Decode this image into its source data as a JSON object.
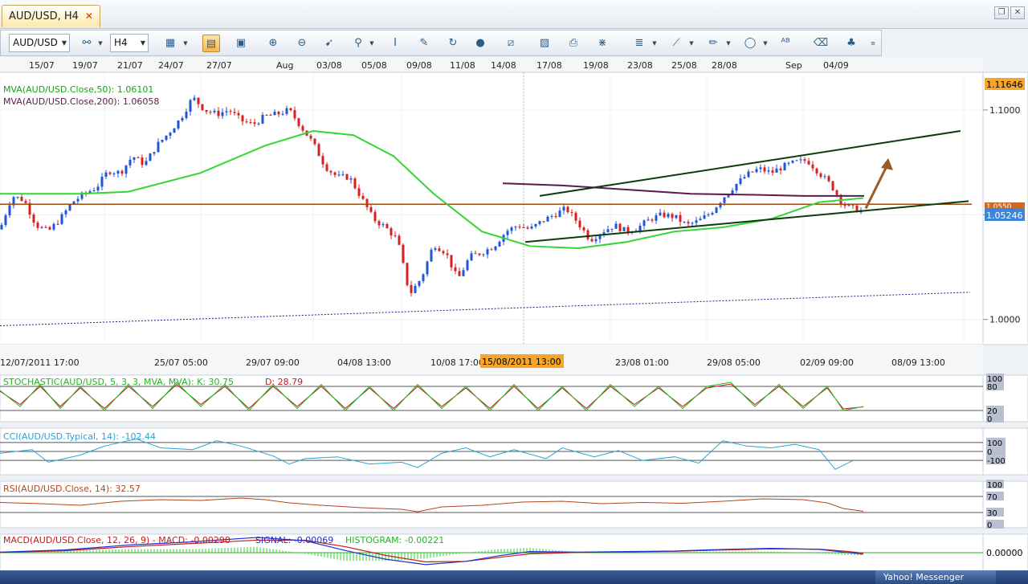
{
  "tab": {
    "label": "AUD/USD, H4",
    "close": "✕"
  },
  "window_controls": {
    "restore": "❐",
    "close": "✕"
  },
  "toolbar": {
    "symbol": "AUD/USD",
    "timeframe": "H4",
    "buttons": [
      "bar-chart-icon",
      "candle-icon",
      "line-icon",
      "crosshair-icon",
      "zoom-in-icon",
      "zoom-out-icon",
      "cursor-icon",
      "magnifier-icon",
      "indicator-icon",
      "draw-icon",
      "refresh-icon",
      "globe-icon",
      "ruler-icon",
      "image-icon",
      "print-icon",
      "fibonacci-icon",
      "channel-icon",
      "trend-icon",
      "pencil-icon",
      "ellipse-icon",
      "text-icon",
      "eraser-icon",
      "tree-icon"
    ]
  },
  "top_dates": [
    "15/07",
    "19/07",
    "21/07",
    "24/07",
    "27/07",
    "Aug",
    "03/08",
    "05/08",
    "09/08",
    "11/08",
    "14/08",
    "17/08",
    "19/08",
    "23/08",
    "25/08",
    "28/08",
    "Sep",
    "04/09"
  ],
  "bottom_dates": [
    "12/07/2011 17:00",
    "25/07 05:00",
    "29/07 09:00",
    "04/08 13:00",
    "10/08 17:00",
    "15/08/2011 13:00",
    "23/08 01:00",
    "29/08 05:00",
    "02/09 09:00",
    "08/09 13:00"
  ],
  "crosshair_date": "15/08/2011 13:00",
  "legend": {
    "mva50": "MVA(AUD/USD.Close,50): 1.06101",
    "mva200": "MVA(AUD/USD.Close,200): 1.06058"
  },
  "price_labels": {
    "top": "1.11646",
    "current": "1.05246",
    "covered": "1.0550",
    "ticks": [
      "1.1000",
      "1.0500",
      "1.0000"
    ]
  },
  "indicators": {
    "stochastic": {
      "label": "STOCHASTIC(AUD/USD, 5, 3, 3, MVA, MVA): K: 30.75",
      "d": "D: 28.79",
      "scale": [
        "100",
        "80",
        "20",
        "0"
      ]
    },
    "cci": {
      "label": "CCI(AUD/USD.Typical, 14): -102.44",
      "scale": [
        "100",
        "0",
        "-100"
      ]
    },
    "rsi": {
      "label": "RSI(AUD/USD.Close, 14): 32.57",
      "scale": [
        "100",
        "70",
        "30",
        "0"
      ]
    },
    "macd": {
      "label": "MACD(AUD/USD.Close, 12, 26, 9) - MACD: -0.00290",
      "signal": "SIGNAL: -0.00069",
      "histogram": "HISTOGRAM: -0.00221",
      "scale": [
        "0.00000"
      ]
    }
  },
  "status": {
    "messenger": "Yahoo! Messenger"
  },
  "chart_data": {
    "type": "candlestick",
    "title": "AUD/USD, H4",
    "ylim": [
      0.988,
      1.118
    ],
    "close_series": [
      [
        0,
        1.043
      ],
      [
        15,
        1.059
      ],
      [
        30,
        1.057
      ],
      [
        45,
        1.045
      ],
      [
        60,
        1.042
      ],
      [
        75,
        1.048
      ],
      [
        90,
        1.056
      ],
      [
        105,
        1.06
      ],
      [
        120,
        1.063
      ],
      [
        135,
        1.071
      ],
      [
        150,
        1.07
      ],
      [
        165,
        1.078
      ],
      [
        180,
        1.074
      ],
      [
        195,
        1.083
      ],
      [
        210,
        1.089
      ],
      [
        225,
        1.096
      ],
      [
        240,
        1.106
      ],
      [
        255,
        1.1
      ],
      [
        270,
        1.098
      ],
      [
        285,
        1.1
      ],
      [
        300,
        1.095
      ],
      [
        315,
        1.093
      ],
      [
        330,
        1.097
      ],
      [
        345,
        1.098
      ],
      [
        360,
        1.1
      ],
      [
        375,
        1.092
      ],
      [
        390,
        1.084
      ],
      [
        405,
        1.073
      ],
      [
        420,
        1.068
      ],
      [
        435,
        1.068
      ],
      [
        450,
        1.058
      ],
      [
        465,
        1.048
      ],
      [
        480,
        1.044
      ],
      [
        495,
        1.038
      ],
      [
        510,
        1.012
      ],
      [
        525,
        1.02
      ],
      [
        540,
        1.036
      ],
      [
        555,
        1.032
      ],
      [
        570,
        1.019
      ],
      [
        585,
        1.03
      ],
      [
        600,
        1.032
      ],
      [
        615,
        1.035
      ],
      [
        630,
        1.042
      ],
      [
        645,
        1.045
      ],
      [
        660,
        1.043
      ],
      [
        675,
        1.047
      ],
      [
        690,
        1.05
      ],
      [
        705,
        1.053
      ],
      [
        720,
        1.046
      ],
      [
        735,
        1.038
      ],
      [
        750,
        1.042
      ],
      [
        765,
        1.045
      ],
      [
        780,
        1.042
      ],
      [
        795,
        1.044
      ],
      [
        810,
        1.048
      ],
      [
        825,
        1.05
      ],
      [
        840,
        1.049
      ],
      [
        855,
        1.045
      ],
      [
        870,
        1.047
      ],
      [
        885,
        1.051
      ],
      [
        900,
        1.058
      ],
      [
        915,
        1.064
      ],
      [
        930,
        1.069
      ],
      [
        945,
        1.072
      ],
      [
        960,
        1.07
      ],
      [
        975,
        1.073
      ],
      [
        990,
        1.075
      ],
      [
        1005,
        1.076
      ],
      [
        1020,
        1.07
      ],
      [
        1035,
        1.064
      ],
      [
        1050,
        1.055
      ],
      [
        1062,
        1.053
      ],
      [
        1072,
        1.052
      ]
    ],
    "mva50_series": [
      [
        0,
        1.06
      ],
      [
        100,
        1.06
      ],
      [
        160,
        1.061
      ],
      [
        250,
        1.07
      ],
      [
        330,
        1.083
      ],
      [
        390,
        1.09
      ],
      [
        440,
        1.088
      ],
      [
        490,
        1.078
      ],
      [
        540,
        1.06
      ],
      [
        600,
        1.042
      ],
      [
        660,
        1.035
      ],
      [
        720,
        1.034
      ],
      [
        780,
        1.037
      ],
      [
        840,
        1.042
      ],
      [
        900,
        1.044
      ],
      [
        960,
        1.048
      ],
      [
        1020,
        1.056
      ],
      [
        1075,
        1.058
      ]
    ],
    "mva200_series": [
      [
        626,
        1.065
      ],
      [
        700,
        1.064
      ],
      [
        780,
        1.062
      ],
      [
        860,
        1.06
      ],
      [
        940,
        1.0595
      ],
      [
        1000,
        1.059
      ],
      [
        1050,
        1.059
      ],
      [
        1076,
        1.059
      ]
    ],
    "support_level": 1.055,
    "channel_upper": [
      [
        672,
        1.059
      ],
      [
        1196,
        1.09
      ]
    ],
    "channel_lower": [
      [
        654,
        1.037
      ],
      [
        1206,
        1.0565
      ]
    ],
    "long_term_line": [
      [
        0,
        0.997
      ],
      [
        1208,
        1.013
      ]
    ],
    "projection_arrow": [
      [
        1078,
        1.053
      ],
      [
        1106,
        1.077
      ]
    ],
    "stochastic_k": [
      [
        0,
        70
      ],
      [
        25,
        30
      ],
      [
        50,
        85
      ],
      [
        75,
        25
      ],
      [
        100,
        80
      ],
      [
        130,
        20
      ],
      [
        160,
        85
      ],
      [
        190,
        25
      ],
      [
        220,
        90
      ],
      [
        250,
        30
      ],
      [
        280,
        85
      ],
      [
        310,
        20
      ],
      [
        340,
        85
      ],
      [
        370,
        25
      ],
      [
        400,
        85
      ],
      [
        430,
        20
      ],
      [
        460,
        80
      ],
      [
        490,
        20
      ],
      [
        520,
        85
      ],
      [
        550,
        25
      ],
      [
        580,
        80
      ],
      [
        610,
        20
      ],
      [
        640,
        85
      ],
      [
        670,
        20
      ],
      [
        700,
        80
      ],
      [
        730,
        20
      ],
      [
        760,
        85
      ],
      [
        790,
        30
      ],
      [
        820,
        80
      ],
      [
        850,
        25
      ],
      [
        880,
        80
      ],
      [
        910,
        90
      ],
      [
        940,
        30
      ],
      [
        970,
        85
      ],
      [
        1000,
        25
      ],
      [
        1030,
        80
      ],
      [
        1050,
        20
      ],
      [
        1075,
        30
      ]
    ],
    "stochastic_d": [
      [
        0,
        68
      ],
      [
        25,
        35
      ],
      [
        50,
        80
      ],
      [
        75,
        30
      ],
      [
        100,
        76
      ],
      [
        130,
        25
      ],
      [
        160,
        80
      ],
      [
        190,
        30
      ],
      [
        220,
        85
      ],
      [
        250,
        35
      ],
      [
        280,
        80
      ],
      [
        310,
        25
      ],
      [
        340,
        80
      ],
      [
        370,
        30
      ],
      [
        400,
        80
      ],
      [
        430,
        25
      ],
      [
        460,
        76
      ],
      [
        490,
        25
      ],
      [
        520,
        80
      ],
      [
        550,
        30
      ],
      [
        580,
        76
      ],
      [
        610,
        25
      ],
      [
        640,
        80
      ],
      [
        670,
        25
      ],
      [
        700,
        76
      ],
      [
        730,
        25
      ],
      [
        760,
        80
      ],
      [
        790,
        35
      ],
      [
        820,
        76
      ],
      [
        850,
        30
      ],
      [
        880,
        76
      ],
      [
        910,
        86
      ],
      [
        940,
        35
      ],
      [
        970,
        80
      ],
      [
        1000,
        30
      ],
      [
        1030,
        76
      ],
      [
        1050,
        24
      ],
      [
        1075,
        29
      ]
    ],
    "cci": [
      [
        0,
        -20
      ],
      [
        40,
        20
      ],
      [
        60,
        -120
      ],
      [
        100,
        -40
      ],
      [
        130,
        60
      ],
      [
        170,
        140
      ],
      [
        200,
        40
      ],
      [
        240,
        20
      ],
      [
        270,
        120
      ],
      [
        300,
        60
      ],
      [
        340,
        -50
      ],
      [
        360,
        -140
      ],
      [
        380,
        -80
      ],
      [
        420,
        -60
      ],
      [
        460,
        -140
      ],
      [
        500,
        -120
      ],
      [
        520,
        -180
      ],
      [
        550,
        -20
      ],
      [
        580,
        40
      ],
      [
        610,
        -60
      ],
      [
        640,
        20
      ],
      [
        680,
        -80
      ],
      [
        700,
        40
      ],
      [
        740,
        -60
      ],
      [
        770,
        10
      ],
      [
        800,
        -100
      ],
      [
        840,
        -60
      ],
      [
        870,
        -130
      ],
      [
        900,
        120
      ],
      [
        930,
        60
      ],
      [
        960,
        40
      ],
      [
        990,
        80
      ],
      [
        1020,
        20
      ],
      [
        1040,
        -200
      ],
      [
        1060,
        -110
      ],
      [
        1062,
        -102
      ]
    ],
    "rsi": [
      [
        0,
        55
      ],
      [
        50,
        52
      ],
      [
        100,
        48
      ],
      [
        150,
        58
      ],
      [
        200,
        62
      ],
      [
        250,
        60
      ],
      [
        300,
        66
      ],
      [
        330,
        62
      ],
      [
        360,
        54
      ],
      [
        400,
        48
      ],
      [
        450,
        42
      ],
      [
        500,
        38
      ],
      [
        520,
        32
      ],
      [
        550,
        44
      ],
      [
        600,
        48
      ],
      [
        650,
        56
      ],
      [
        700,
        58
      ],
      [
        750,
        52
      ],
      [
        800,
        55
      ],
      [
        850,
        53
      ],
      [
        900,
        58
      ],
      [
        950,
        64
      ],
      [
        1000,
        62
      ],
      [
        1030,
        54
      ],
      [
        1050,
        40
      ],
      [
        1075,
        33
      ]
    ],
    "macd": [
      [
        0,
        0.001
      ],
      [
        80,
        0.005
      ],
      [
        160,
        0.014
      ],
      [
        240,
        0.02
      ],
      [
        320,
        0.028
      ],
      [
        380,
        0.022
      ],
      [
        430,
        0.004
      ],
      [
        480,
        -0.012
      ],
      [
        530,
        -0.022
      ],
      [
        580,
        -0.016
      ],
      [
        620,
        -0.006
      ],
      [
        660,
        0.002
      ],
      [
        720,
        0.001
      ],
      [
        780,
        0.002
      ],
      [
        840,
        0.003
      ],
      [
        900,
        0.006
      ],
      [
        960,
        0.008
      ],
      [
        1020,
        0.006
      ],
      [
        1050,
        0.001
      ],
      [
        1075,
        -0.0029
      ]
    ],
    "signal": [
      [
        0,
        0.0005
      ],
      [
        80,
        0.0035
      ],
      [
        160,
        0.011
      ],
      [
        240,
        0.017
      ],
      [
        320,
        0.023
      ],
      [
        380,
        0.023
      ],
      [
        430,
        0.011
      ],
      [
        480,
        -0.005
      ],
      [
        530,
        -0.017
      ],
      [
        580,
        -0.016
      ],
      [
        620,
        -0.009
      ],
      [
        660,
        -0.002
      ],
      [
        720,
        0.0005
      ],
      [
        780,
        0.0015
      ],
      [
        840,
        0.0025
      ],
      [
        900,
        0.005
      ],
      [
        960,
        0.007
      ],
      [
        1020,
        0.0065
      ],
      [
        1050,
        0.003
      ],
      [
        1075,
        -0.0007
      ]
    ]
  }
}
